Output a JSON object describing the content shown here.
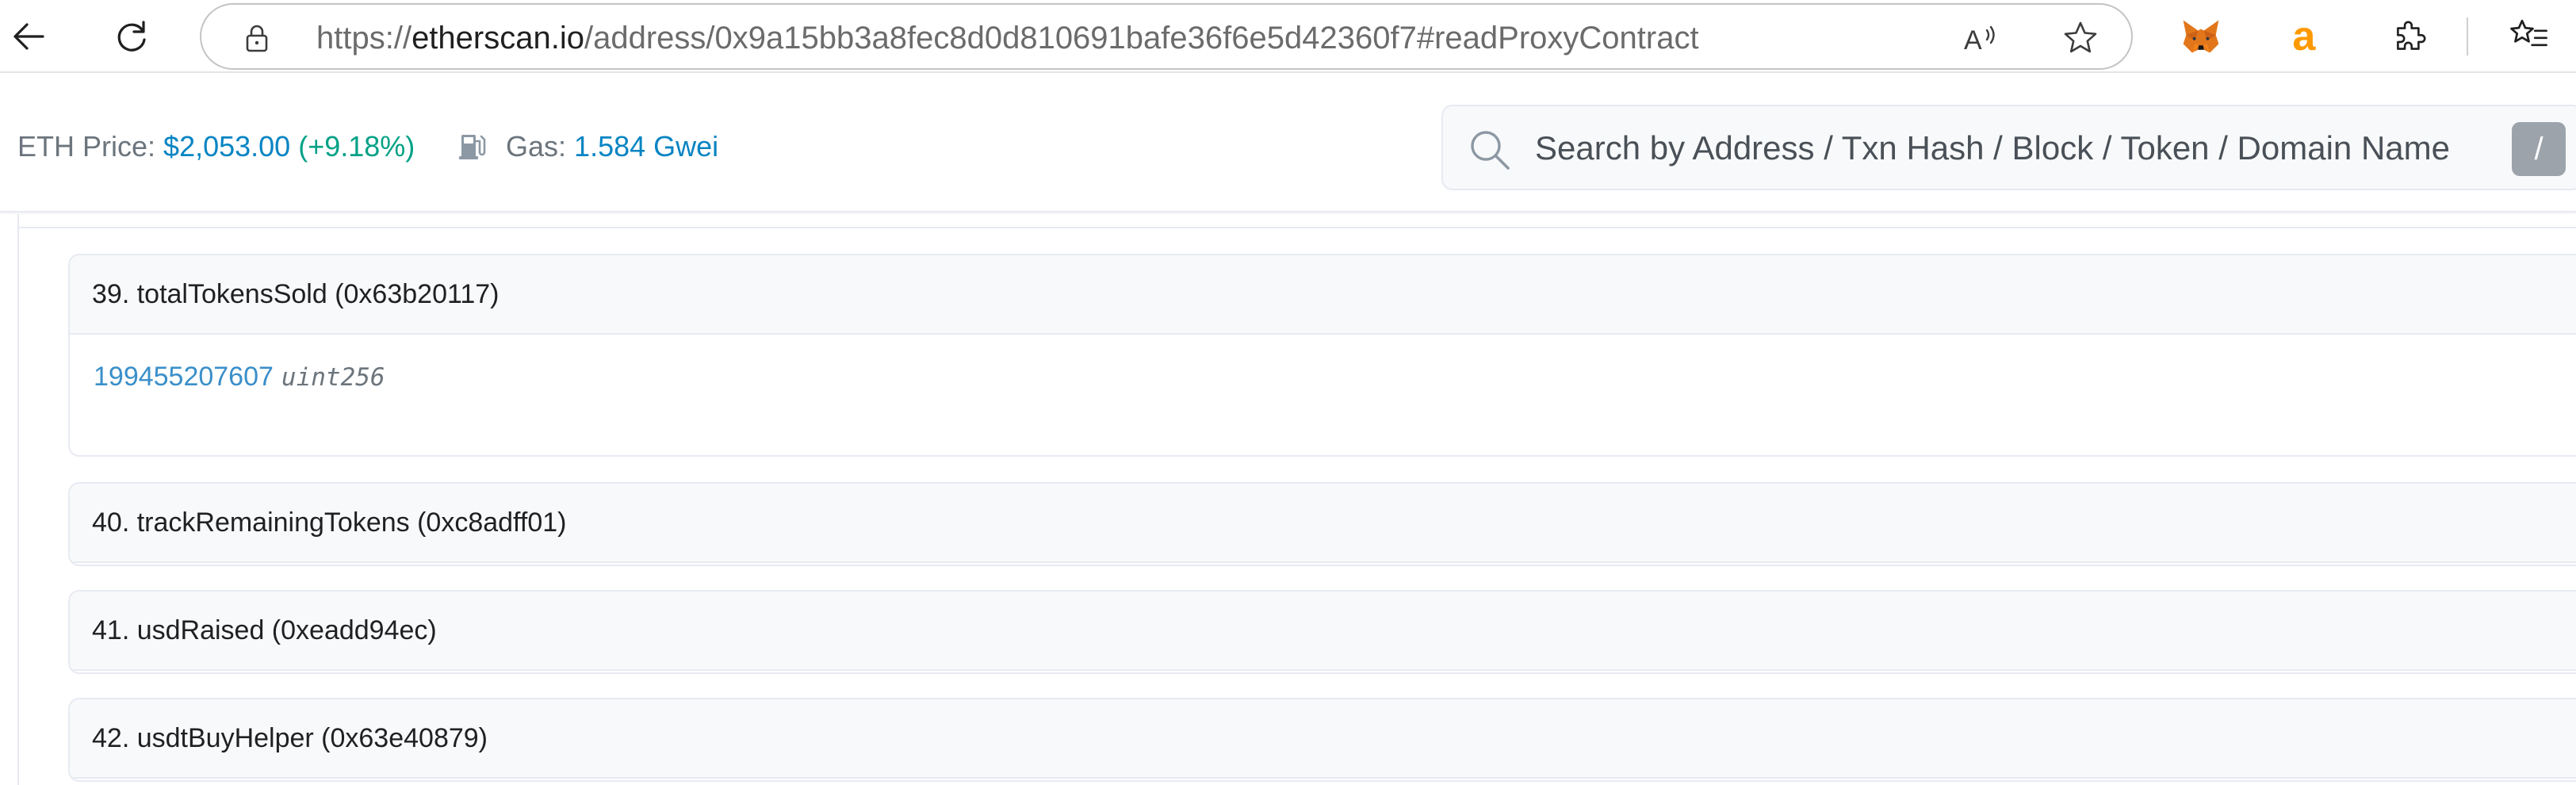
{
  "browser": {
    "url_prefix": "https://",
    "url_host": "etherscan.io",
    "url_path": "/address/0x9a15bb3a8fec8d0d810691bafe36f6e5d42360f7#readProxyContract"
  },
  "header": {
    "eth_price_label": "ETH Price:",
    "eth_price_value": "$2,053.00",
    "eth_price_change": "(+9.18%)",
    "gas_label": "Gas:",
    "gas_value": "1.584 Gwei",
    "search_placeholder": "Search by Address / Txn Hash / Block / Token / Domain Name",
    "search_shortcut": "/"
  },
  "functions": [
    {
      "title": "39. totalTokensSold (0x63b20117)",
      "value": "199455207607",
      "type": "uint256"
    },
    {
      "title": "40. trackRemainingTokens (0xc8adff01)"
    },
    {
      "title": "41. usdRaised (0xeadd94ec)"
    },
    {
      "title": "42. usdtBuyHelper (0x63e40879)"
    }
  ],
  "colors": {
    "link": "#0784c3",
    "positive": "#00a186",
    "card_header_bg": "#f8f9fa",
    "border": "#e7eaf3"
  },
  "icons": [
    "back-icon",
    "refresh-icon",
    "lock-icon",
    "read-aloud-icon",
    "favorite-star-icon",
    "metamask-icon",
    "amazon-icon",
    "extensions-icon",
    "favorites-icon",
    "gas-pump-icon",
    "search-icon"
  ]
}
